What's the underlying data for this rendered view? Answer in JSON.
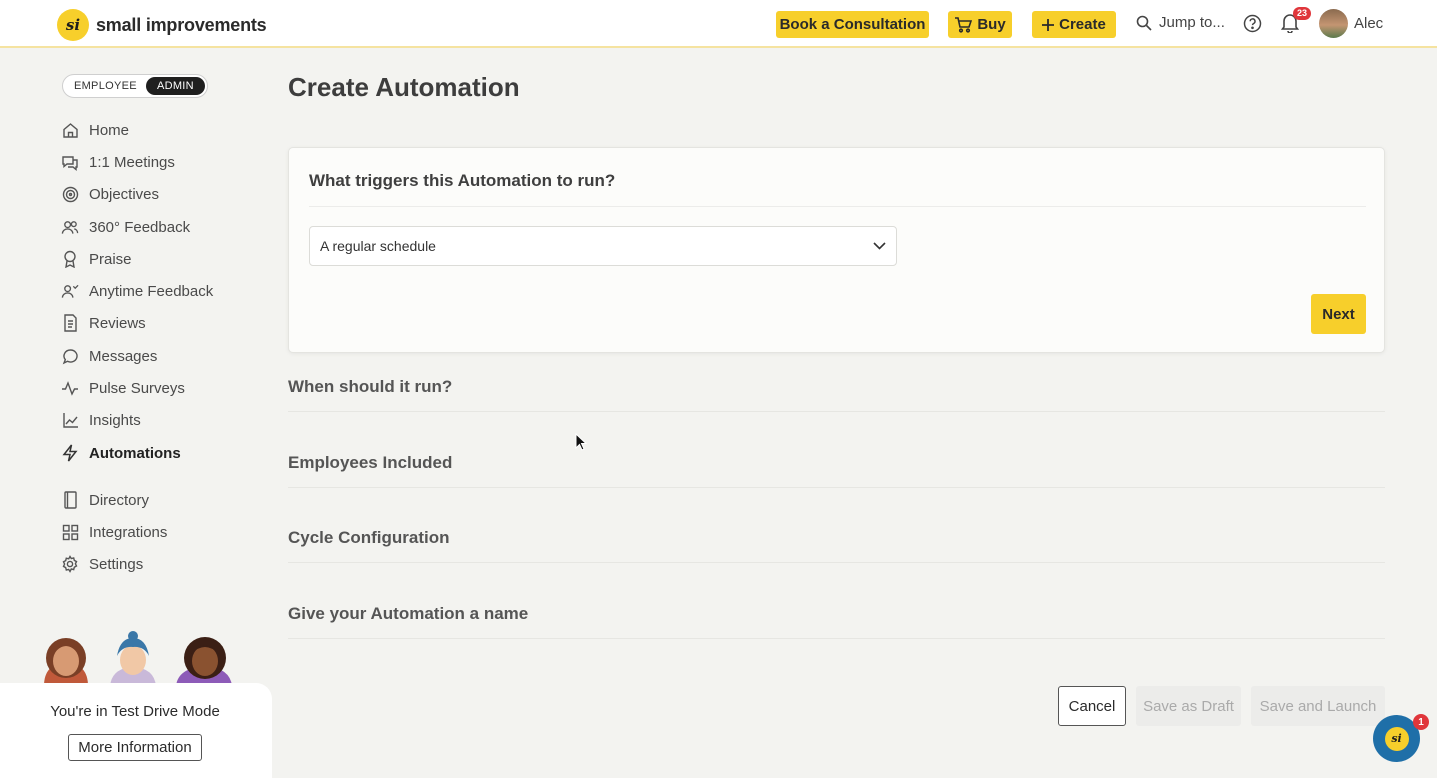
{
  "header": {
    "logo_mark": "si",
    "brand": "small improvements",
    "book_label": "Book a Consultation",
    "buy_label": "Buy",
    "create_label": "Create",
    "jump_label": "Jump to...",
    "notification_count": "23",
    "user_name": "Alec"
  },
  "sidebar": {
    "role_employee": "EMPLOYEE",
    "role_admin": "ADMIN",
    "items": [
      {
        "label": "Home",
        "icon": "home-icon"
      },
      {
        "label": "1:1 Meetings",
        "icon": "meetings-icon"
      },
      {
        "label": "Objectives",
        "icon": "target-icon"
      },
      {
        "label": "360° Feedback",
        "icon": "people-icon"
      },
      {
        "label": "Praise",
        "icon": "award-icon"
      },
      {
        "label": "Anytime Feedback",
        "icon": "user-feedback-icon"
      },
      {
        "label": "Reviews",
        "icon": "document-icon"
      },
      {
        "label": "Messages",
        "icon": "message-icon"
      },
      {
        "label": "Pulse Surveys",
        "icon": "pulse-icon"
      },
      {
        "label": "Insights",
        "icon": "chart-icon"
      },
      {
        "label": "Automations",
        "icon": "lightning-icon"
      },
      {
        "label": "Directory",
        "icon": "book-icon"
      },
      {
        "label": "Integrations",
        "icon": "grid-icon"
      },
      {
        "label": "Settings",
        "icon": "gear-icon"
      }
    ],
    "active": "Automations",
    "test_drive_text": "You're in Test Drive Mode",
    "more_info_label": "More Information"
  },
  "main": {
    "title": "Create Automation",
    "trigger_question": "What triggers this Automation to run?",
    "trigger_value": "A regular schedule",
    "next_label": "Next",
    "sections": [
      "When should it run?",
      "Employees Included",
      "Cycle Configuration",
      "Give your Automation a name"
    ],
    "cancel_label": "Cancel",
    "save_draft_label": "Save as Draft",
    "save_launch_label": "Save and Launch"
  },
  "chat": {
    "logo_mark": "si",
    "badge": "1"
  },
  "colors": {
    "accent": "#f7cf2b",
    "badge": "#e0363b",
    "chat": "#1f6fa8"
  }
}
